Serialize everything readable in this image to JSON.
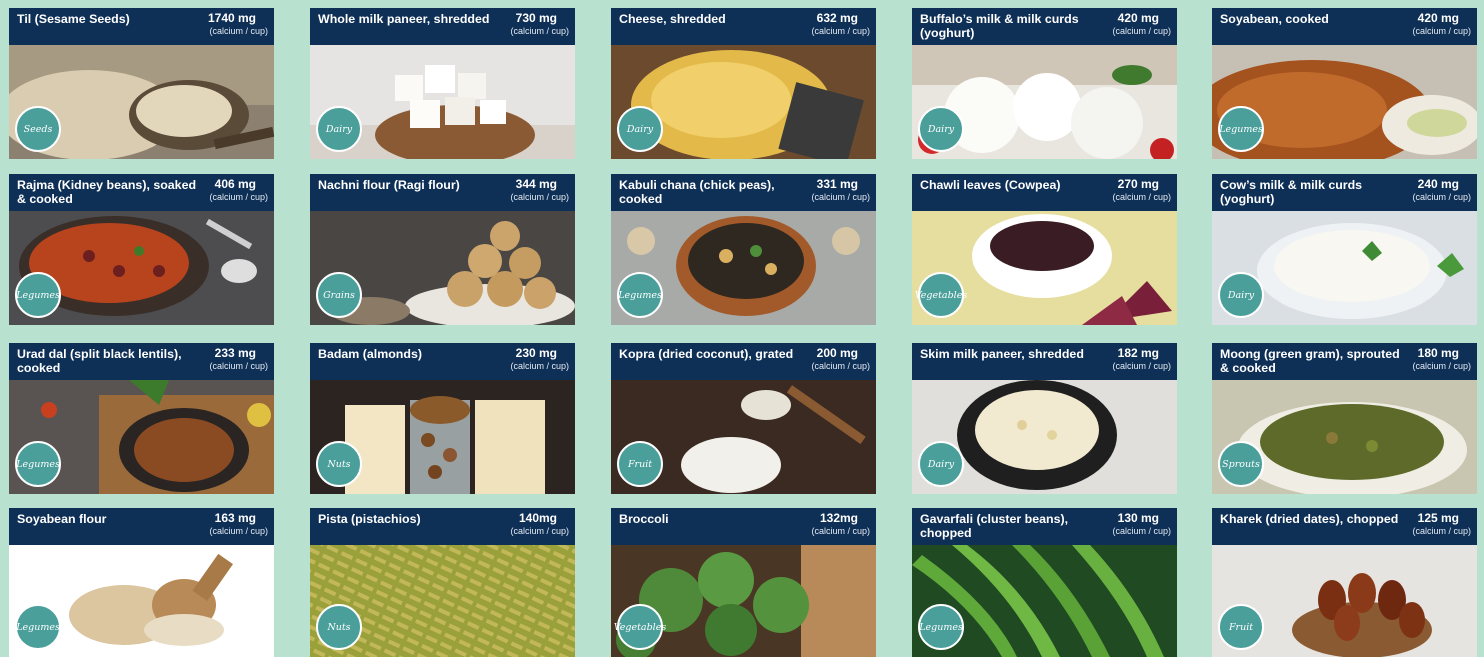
{
  "unit_label": "(calcium / cup)",
  "cards": [
    {
      "title": "Til (Sesame Seeds)",
      "value": "1740 mg",
      "category": "Seeds"
    },
    {
      "title": "Whole milk paneer, shredded",
      "value": "730 mg",
      "category": "Dairy"
    },
    {
      "title": "Cheese, shredded",
      "value": "632 mg",
      "category": "Dairy"
    },
    {
      "title": "Buffalo’s milk & milk curds (yoghurt)",
      "value": "420 mg",
      "category": "Dairy"
    },
    {
      "title": "Soyabean, cooked",
      "value": "420 mg",
      "category": "Legumes"
    },
    {
      "title": "Rajma (Kidney beans), soaked & cooked",
      "value": "406 mg",
      "category": "Legumes"
    },
    {
      "title": "Nachni flour (Ragi flour)",
      "value": "344 mg",
      "category": "Grains"
    },
    {
      "title": "Kabuli chana (chick peas), cooked",
      "value": "331 mg",
      "category": "Legumes"
    },
    {
      "title": "Chawli leaves (Cowpea)",
      "value": "270 mg",
      "category": "Vegetables"
    },
    {
      "title": "Cow’s milk & milk curds (yoghurt)",
      "value": "240 mg",
      "category": "Dairy"
    },
    {
      "title": "Urad dal (split black lentils), cooked",
      "value": "233 mg",
      "category": "Legumes"
    },
    {
      "title": "Badam (almonds)",
      "value": "230 mg",
      "category": "Nuts"
    },
    {
      "title": "Kopra (dried coconut), grated",
      "value": "200 mg",
      "category": "Fruit"
    },
    {
      "title": "Skim milk paneer, shredded",
      "value": "182 mg",
      "category": "Dairy"
    },
    {
      "title": "Moong (green gram), sprouted & cooked",
      "value": "180 mg",
      "category": "Sprouts"
    },
    {
      "title": "Soyabean flour",
      "value": "163 mg",
      "category": "Legumes"
    },
    {
      "title": "Pista (pistachios)",
      "value": "140mg",
      "category": "Nuts"
    },
    {
      "title": "Broccoli",
      "value": "132mg",
      "category": "Vegetables"
    },
    {
      "title": "Gavarfali (cluster beans), chopped",
      "value": "130 mg",
      "category": "Legumes"
    },
    {
      "title": "Kharek (dried dates), chopped",
      "value": "125 mg",
      "category": "Fruit"
    }
  ],
  "colors": {
    "background": "#b8e2cf",
    "header": "#0e2f56",
    "badge": "#4a9f9b"
  }
}
